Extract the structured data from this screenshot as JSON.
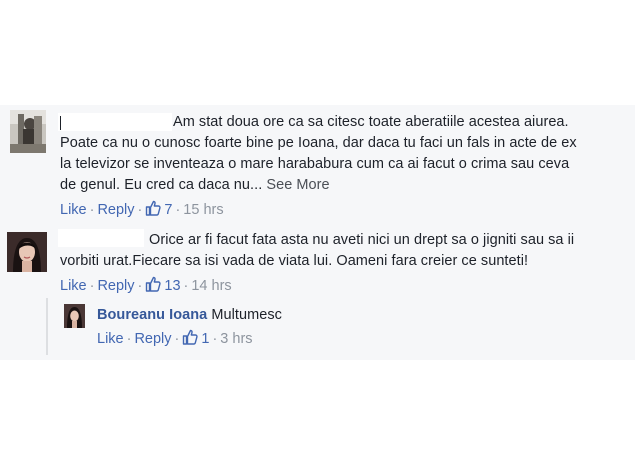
{
  "comments": [
    {
      "author": "",
      "lines": [
        "Am stat doua ore ca sa citesc toate aberatiile acestea aiurea.",
        "Poate ca nu o cunosc foarte bine pe Ioana, dar daca tu faci un fals in acte de ex",
        "la televizor se inventeaza o mare harababura cum ca ai facut o crima sau ceva",
        "de genul. Eu cred ca daca nu..."
      ],
      "see_more": "See More",
      "like_label": "Like",
      "reply_label": "Reply",
      "like_count": "7",
      "time": "15 hrs"
    },
    {
      "author": "",
      "lines": [
        "Orice ar fi facut fata asta nu aveti nici un drept sa o jigniti sau sa ii",
        "vorbiti urat.Fiecare sa isi vada de viata lui. Oameni fara creier ce sunteti!"
      ],
      "like_label": "Like",
      "reply_label": "Reply",
      "like_count": "13",
      "time": "14 hrs"
    }
  ],
  "reply": {
    "author": "Boureanu Ioana",
    "text": "Multumesc",
    "like_label": "Like",
    "reply_label": "Reply",
    "like_count": "1",
    "time": "3 hrs"
  },
  "colors": {
    "link": "#4267b2",
    "author": "#365899",
    "meta": "#8d949e",
    "background": "#f6f7f9"
  },
  "icons": [
    "thumbs-up-icon"
  ]
}
